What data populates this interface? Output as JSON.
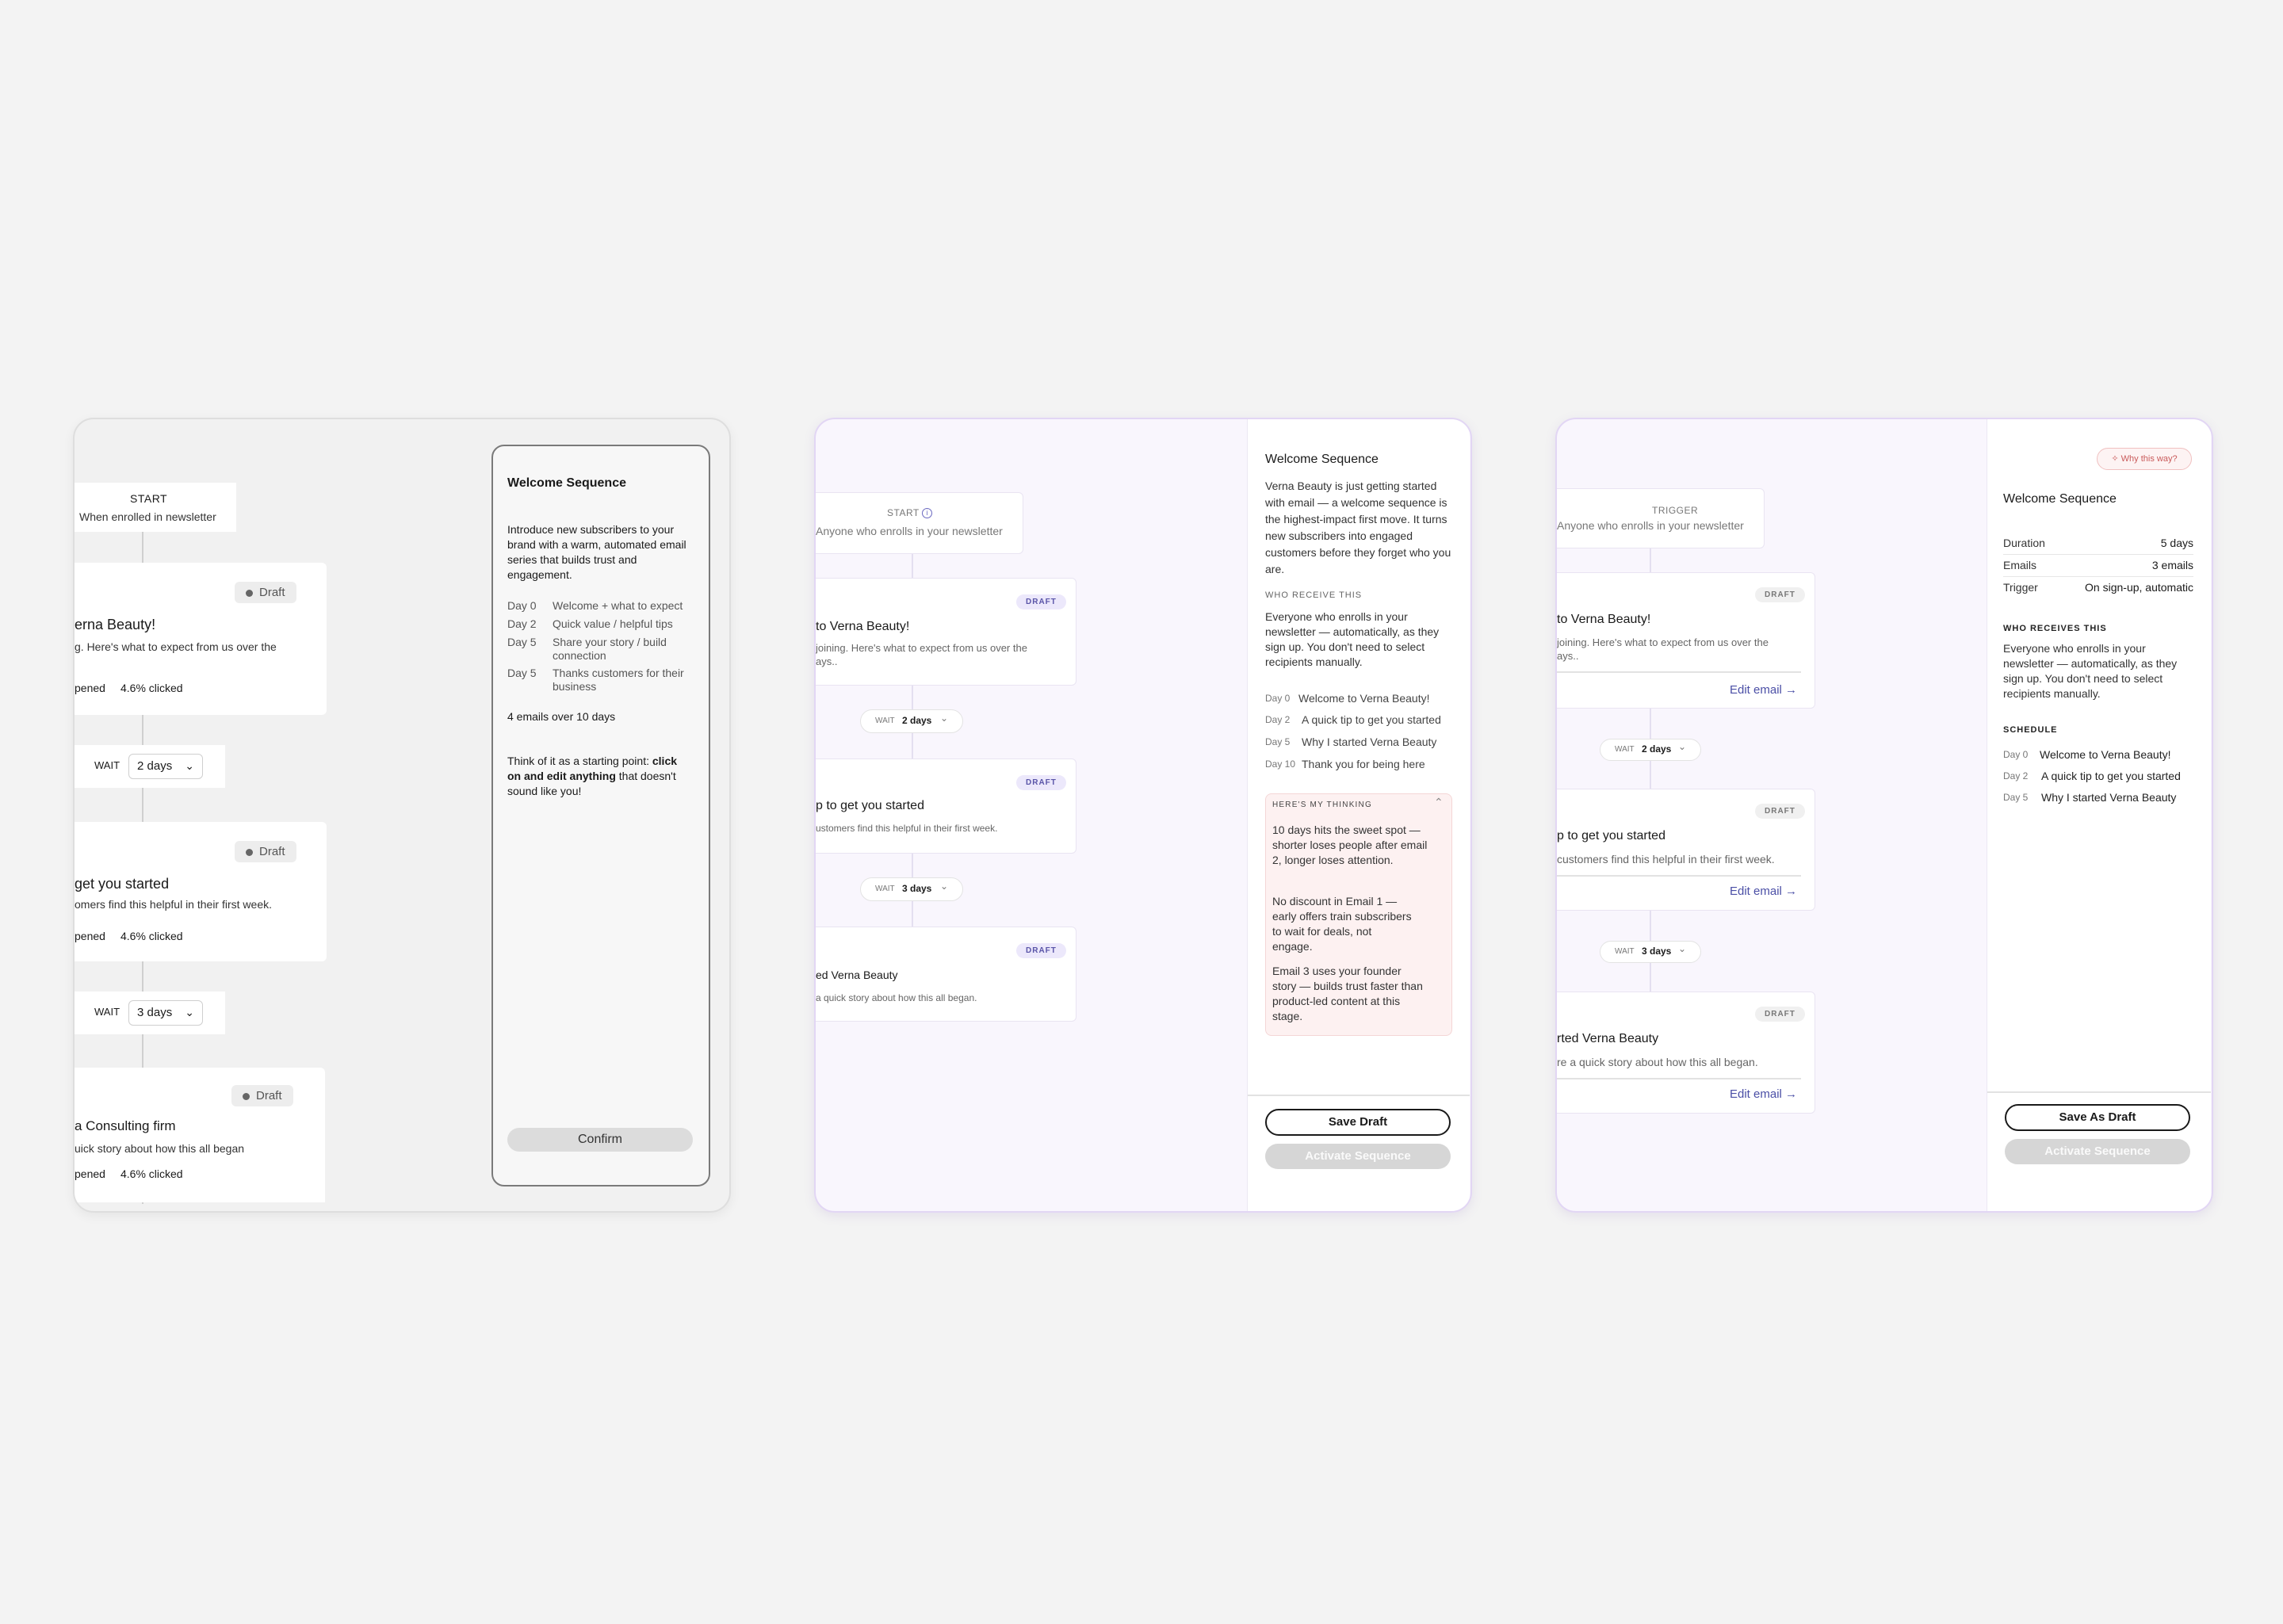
{
  "frame1": {
    "start_label": "START",
    "start_sub": "When enrolled in newsletter",
    "emails": [
      {
        "badge": "Draft",
        "title": "erna Beauty!",
        "desc": "g. Here's what to expect from us over the",
        "opened": "pened",
        "clicked": "4.6%  clicked"
      },
      {
        "badge": "Draft",
        "title": "get you started",
        "desc": "omers find this helpful in their first week.",
        "opened": "pened",
        "clicked": "4.6%  clicked"
      },
      {
        "badge": "Draft",
        "title": "a Consulting firm",
        "desc": "uick story about how this all began",
        "opened": "pened",
        "clicked": "4.6%  clicked"
      }
    ],
    "waits": [
      {
        "label": "WAIT",
        "value": "2 days"
      },
      {
        "label": "WAIT",
        "value": "3 days"
      }
    ],
    "panel": {
      "title": "Welcome Sequence",
      "intro": "Introduce new subscribers to your brand with a warm, automated email series that builds trust and engagement.",
      "schedule": [
        {
          "day": "Day 0",
          "text": "Welcome + what to expect"
        },
        {
          "day": "Day 2",
          "text": "Quick value / helpful tips"
        },
        {
          "day": "Day 5",
          "text": "Share your story / build connection"
        },
        {
          "day": "Day 5",
          "text": "Thanks customers for their business"
        }
      ],
      "summary": "4 emails over 10 days",
      "tip_plain_1": "Think of it as a starting point: ",
      "tip_bold": "click on and edit anything",
      "tip_plain_2": " that doesn't sound like you!",
      "confirm": "Confirm"
    }
  },
  "frame2": {
    "start_label": "START",
    "start_sub": "Anyone who enrolls in your newsletter",
    "emails": [
      {
        "badge": "DRAFT",
        "title": "to Verna Beauty!",
        "desc1": "joining. Here's what to expect from us over the",
        "desc2": "ays.."
      },
      {
        "badge": "DRAFT",
        "title": "p to get you started",
        "desc1": "ustomers find this helpful in their first week."
      },
      {
        "badge": "DRAFT",
        "title": "ed Verna Beauty",
        "desc1": "a quick story about how this all began."
      }
    ],
    "waits": [
      {
        "label": "WAIT",
        "value": "2 days"
      },
      {
        "label": "WAIT",
        "value": "3 days"
      }
    ],
    "panel": {
      "title": "Welcome Sequence",
      "intro": "Verna Beauty is just getting started with email — a welcome sequence is the highest-impact first move. It turns new subscribers into engaged customers before they forget who you are.",
      "who_label": "WHO RECEIVE THIS",
      "who_text": "Everyone who enrolls in your newsletter — automatically, as they sign up. You don't need to select recipients manually.",
      "schedule": [
        {
          "day": "Day 0",
          "text": "Welcome to Verna Beauty!"
        },
        {
          "day": "Day 2",
          "text": "A quick tip to get you started"
        },
        {
          "day": "Day 5",
          "text": "Why I started Verna Beauty"
        },
        {
          "day": "Day 10",
          "text": "Thank you for being here"
        }
      ],
      "thinking_label": "HERE'S MY THINKING",
      "thinking": [
        "10 days hits the sweet spot — shorter loses people after email 2, longer loses attention.",
        "No discount in Email 1 — early offers train subscribers to wait for deals, not engage.",
        "Email 3 uses your founder story — builds trust faster than product-led content at this stage."
      ],
      "save": "Save Draft",
      "activate": "Activate Sequence"
    }
  },
  "frame3": {
    "start_label": "TRIGGER",
    "start_sub": "Anyone who enrolls in your newsletter",
    "emails": [
      {
        "badge": "DRAFT",
        "title": "to Verna Beauty!",
        "desc1": "joining. Here's what to expect from us over the",
        "desc2": "ays..",
        "edit": "Edit email"
      },
      {
        "badge": "DRAFT",
        "title": "p to get you started",
        "desc1": "customers find this helpful in their first week.",
        "edit": "Edit email"
      },
      {
        "badge": "DRAFT",
        "title": "rted Verna Beauty",
        "desc1": "re a quick story about how this all began.",
        "edit": "Edit email"
      }
    ],
    "waits": [
      {
        "label": "WAIT",
        "value": "2 days"
      },
      {
        "label": "WAIT",
        "value": "3 days"
      }
    ],
    "panel": {
      "why": "Why this way?",
      "title": "Welcome Sequence",
      "stats": [
        {
          "label": "Duration",
          "value": "5 days"
        },
        {
          "label": "Emails",
          "value": "3 emails"
        },
        {
          "label": "Trigger",
          "value": "On sign-up, automatic"
        }
      ],
      "who_label": "WHO RECEIVES THIS",
      "who_text": "Everyone who enrolls in your newsletter — automatically, as they sign up. You don't need to select recipients manually.",
      "schedule_label": "SCHEDULE",
      "schedule": [
        {
          "day": "Day 0",
          "text": "Welcome to Verna Beauty!"
        },
        {
          "day": "Day 2",
          "text": "A quick tip to get you started"
        },
        {
          "day": "Day 5",
          "text": "Why I started Verna Beauty"
        }
      ],
      "save": "Save As Draft",
      "activate": "Activate Sequence"
    }
  }
}
